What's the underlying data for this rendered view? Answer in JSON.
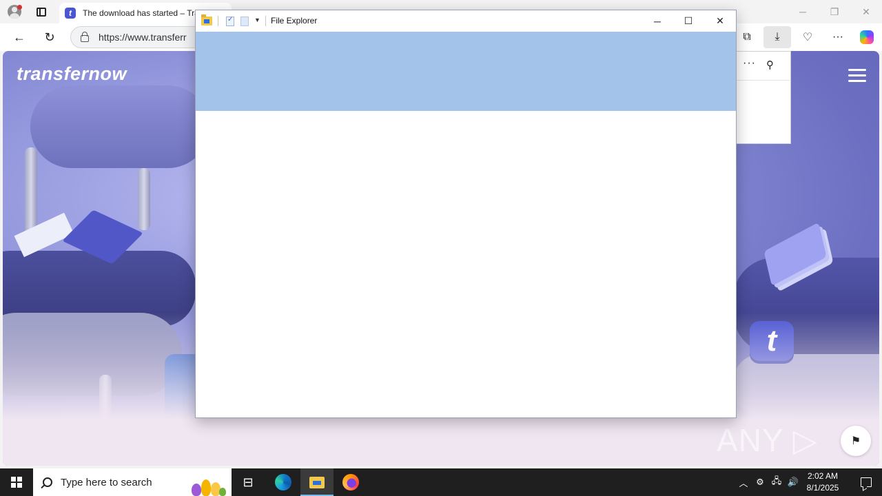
{
  "browser": {
    "tab_title": "The download has started – Tra",
    "tab_favicon_letter": "t",
    "address_url": "https://www.transferr",
    "icons": {
      "profile": "profile-icon",
      "tab_actions": "tab-actions-icon",
      "back": "back-arrow-icon",
      "refresh": "refresh-icon",
      "lock": "lock-icon",
      "collections": "collections-icon",
      "downloads": "download-icon",
      "browser_essentials": "heartbeat-icon",
      "more": "more-icon",
      "copilot": "copilot-icon"
    }
  },
  "site": {
    "brand": "transfernow",
    "logo_letter": "t",
    "watermark": "ANY ▷ RUN"
  },
  "downloads_panel": {
    "more_label": "···",
    "pin_label": "⚲"
  },
  "file_explorer": {
    "title": "File Explorer",
    "ribbon_color": "#a4c3ea"
  },
  "taskbar": {
    "search_placeholder": "Type here to search",
    "time": "2:02 AM",
    "date": "8/1/2025"
  },
  "colors": {
    "brand_primary": "#4b56d2",
    "accent": "#76b9ed"
  }
}
